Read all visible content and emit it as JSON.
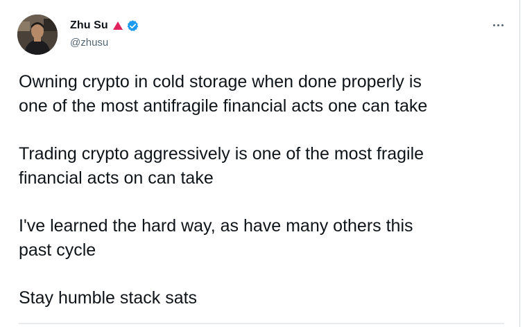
{
  "author": {
    "name": "Zhu Su",
    "handle": "@zhusu"
  },
  "icons": {
    "badge": "red-triangle-icon",
    "verified": "verified-badge-icon",
    "more": "more-horizontal-icon"
  },
  "colors": {
    "verified_blue": "#1d9bf0",
    "badge_red": "#e0245e",
    "secondary_text": "#536471",
    "primary_text": "#0f1419"
  },
  "tweet": {
    "paragraphs": [
      {
        "line1": "Owning crypto in cold storage when done properly is",
        "line2": "one of the most antifragile financial acts one can take"
      },
      {
        "line1": "Trading crypto aggressively is one of the most fragile",
        "line2": "financial acts on can take"
      },
      {
        "line1": "I've learned the hard way, as have many others this",
        "line2": "past cycle"
      },
      {
        "line1": "Stay humble stack sats",
        "line2": ""
      }
    ]
  }
}
